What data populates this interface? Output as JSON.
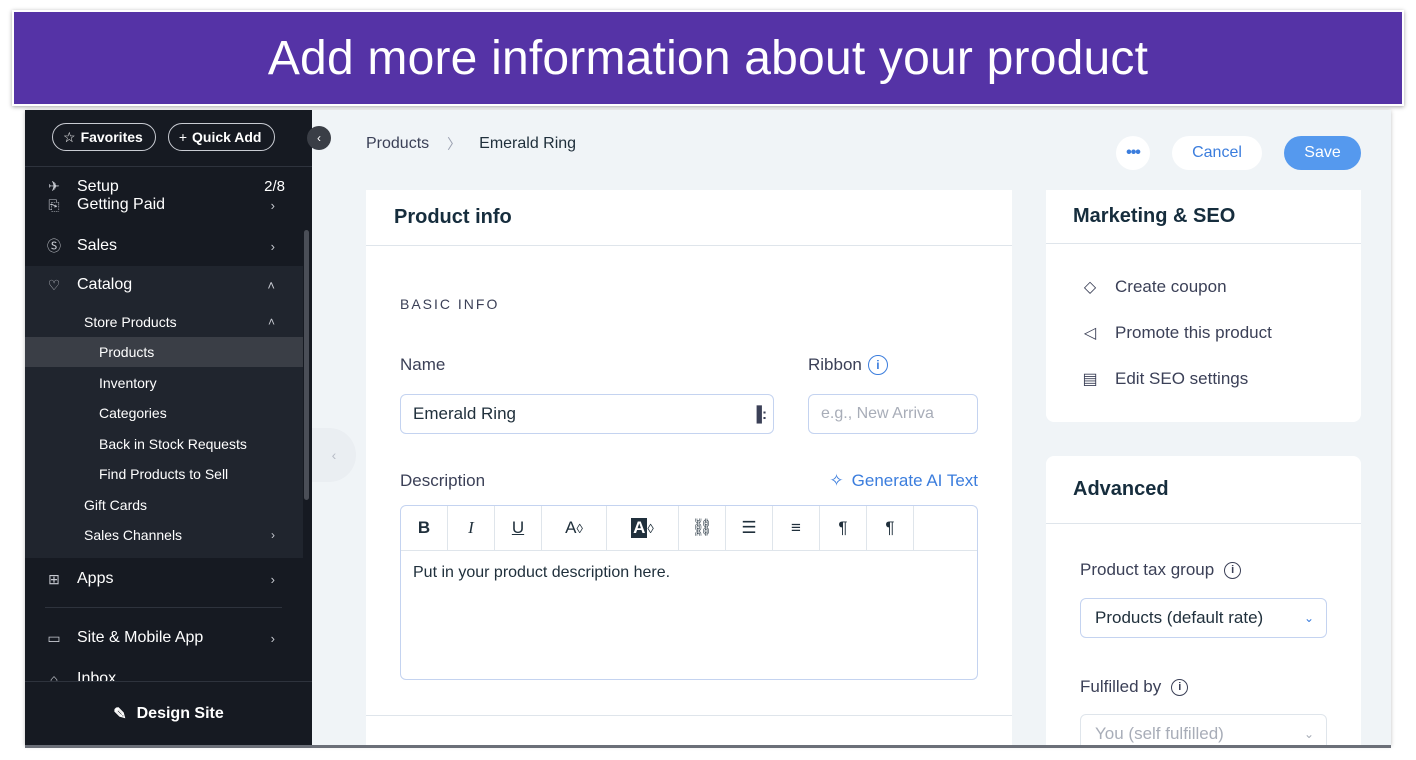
{
  "banner": {
    "text": "Add more information about your product",
    "color": "#5533a6"
  },
  "sidebar": {
    "favorites_label": "Favorites",
    "quick_add_label": "Quick Add",
    "setup": {
      "label": "Setup",
      "count": "2/8"
    },
    "getting_paid": {
      "label": "Getting Paid"
    },
    "sales": {
      "label": "Sales"
    },
    "catalog": {
      "label": "Catalog"
    },
    "store_products": {
      "label": "Store Products"
    },
    "sub_items": [
      {
        "label": "Products",
        "active": true
      },
      {
        "label": "Inventory"
      },
      {
        "label": "Categories"
      },
      {
        "label": "Back in Stock Requests"
      },
      {
        "label": "Find Products to Sell"
      }
    ],
    "gift_cards": {
      "label": "Gift Cards"
    },
    "sales_channels": {
      "label": "Sales Channels"
    },
    "apps": {
      "label": "Apps"
    },
    "site_mobile": {
      "label": "Site & Mobile App"
    },
    "inbox": {
      "label": "Inbox"
    },
    "design_site_label": "Design Site"
  },
  "header": {
    "breadcrumb": [
      "Products",
      "Emerald Ring"
    ],
    "more_label": "•••",
    "cancel_label": "Cancel",
    "save_label": "Save",
    "accent": "#5599ee"
  },
  "product_info": {
    "title": "Product info",
    "section_label": "BASIC INFO",
    "name_label": "Name",
    "name_value": "Emerald Ring",
    "ribbon_label": "Ribbon",
    "ribbon_placeholder": "e.g., New Arriva",
    "description_label": "Description",
    "ai_link": "Generate AI Text",
    "toolbar": [
      "B",
      "I",
      "U",
      "A",
      "A",
      "link",
      "bulleted-list",
      "numbered-list",
      "ltr",
      "rtl"
    ],
    "description_placeholder": "Put in your product description here."
  },
  "marketing": {
    "title": "Marketing & SEO",
    "items": [
      "Create coupon",
      "Promote this product",
      "Edit SEO settings"
    ]
  },
  "advanced": {
    "title": "Advanced",
    "tax_label": "Product tax group",
    "tax_value": "Products (default rate)",
    "fulfilled_label": "Fulfilled by",
    "fulfilled_value": "You (self fulfilled)"
  }
}
